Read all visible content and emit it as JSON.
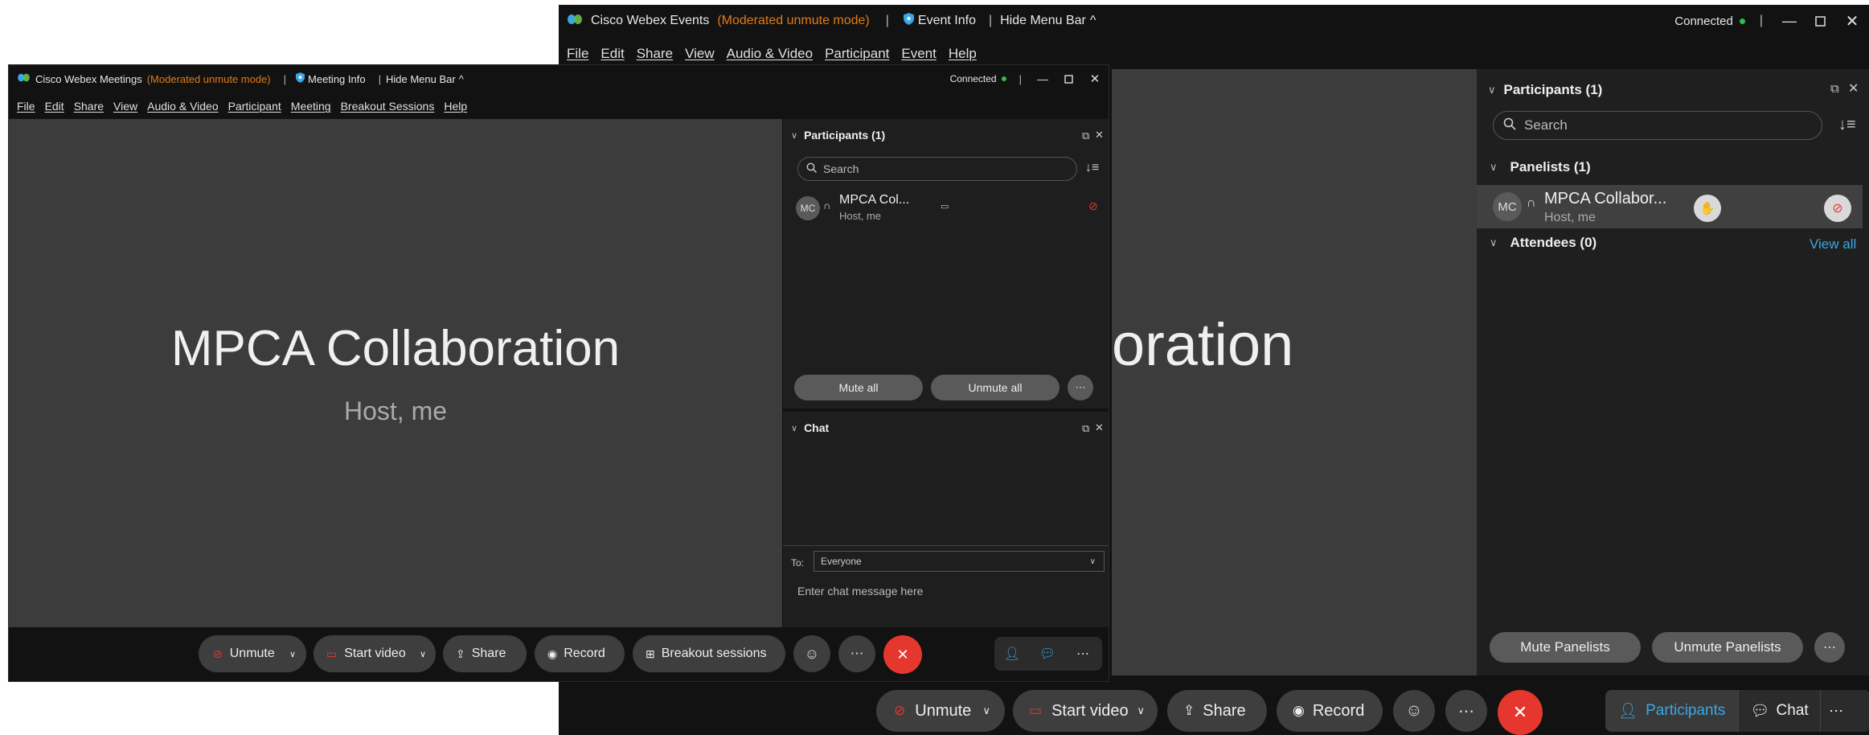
{
  "events": {
    "title": "Cisco Webex Events",
    "mode": "(Moderated unmute mode)",
    "info": "Event Info",
    "hide_menu": "Hide Menu Bar",
    "status": "Connected",
    "menu": [
      "File",
      "Edit",
      "Share",
      "View",
      "Audio & Video",
      "Participant",
      "Event",
      "Help"
    ],
    "stage_text": "oration",
    "participants": {
      "header": "Participants (1)",
      "search_placeholder": "Search",
      "panelists_header": "Panelists (1)",
      "panelist": {
        "initials": "MC",
        "name": "MPCA Collabor...",
        "role": "Host, me"
      },
      "attendees_header": "Attendees (0)",
      "view_all": "View all",
      "mute_label": "Mute Panelists",
      "unmute_label": "Unmute Panelists"
    },
    "controls": {
      "unmute": "Unmute",
      "start_video": "Start video",
      "share": "Share",
      "record": "Record",
      "participants": "Participants",
      "chat": "Chat"
    }
  },
  "meetings": {
    "title": "Cisco Webex Meetings",
    "mode": "(Moderated unmute mode)",
    "info": "Meeting Info",
    "hide_menu": "Hide Menu Bar",
    "status": "Connected",
    "menu": [
      "File",
      "Edit",
      "Share",
      "View",
      "Audio & Video",
      "Participant",
      "Meeting",
      "Breakout Sessions",
      "Help"
    ],
    "stage_title": "MPCA Collaboration",
    "stage_sub": "Host, me",
    "participants": {
      "header": "Participants (1)",
      "search_placeholder": "Search",
      "participant": {
        "initials": "MC",
        "name": "MPCA Col...",
        "role": "Host, me"
      },
      "mute_all": "Mute all",
      "unmute_all": "Unmute all"
    },
    "chat": {
      "header": "Chat",
      "to_label": "To:",
      "to_value": "Everyone",
      "placeholder": "Enter chat message here"
    },
    "controls": {
      "unmute": "Unmute",
      "start_video": "Start video",
      "share": "Share",
      "record": "Record",
      "breakout": "Breakout sessions"
    }
  },
  "colors": {
    "accent": "#3aa7e6",
    "end": "#e5372e",
    "mode": "#e07a1a",
    "connected": "#2fbf4a"
  }
}
